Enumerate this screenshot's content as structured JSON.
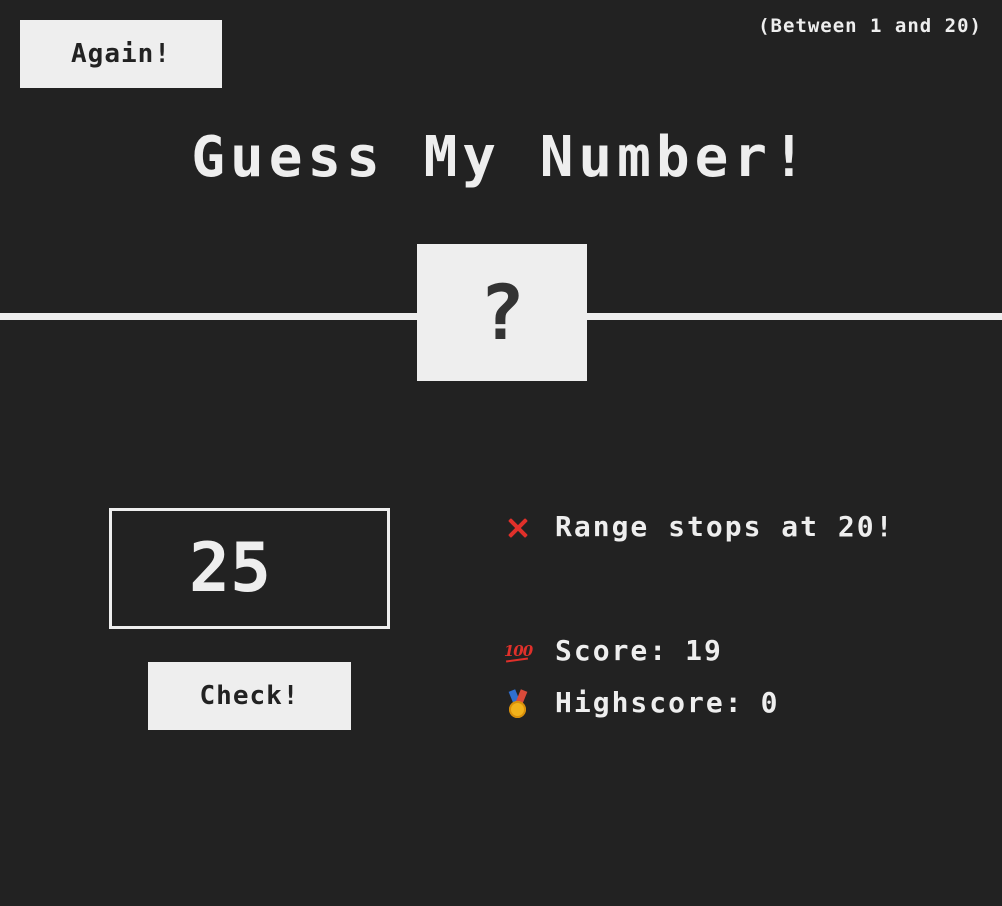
{
  "header": {
    "again_label": "Again!",
    "range_hint": "(Between 1 and 20)",
    "title": "Guess My Number!"
  },
  "secret": {
    "display": "?"
  },
  "guess": {
    "value": "25",
    "check_label": "Check!"
  },
  "status": {
    "message": "Range stops at 20!",
    "score_label": "Score:",
    "score_value": "19",
    "highscore_label": "Highscore:",
    "highscore_value": "0"
  },
  "icons": {
    "message": "cross-mark-icon",
    "score": "hundred-points-icon",
    "highscore": "medal-icon"
  },
  "colors": {
    "background": "#222222",
    "foreground": "#eeeeee",
    "error_accent": "#e0302a"
  }
}
